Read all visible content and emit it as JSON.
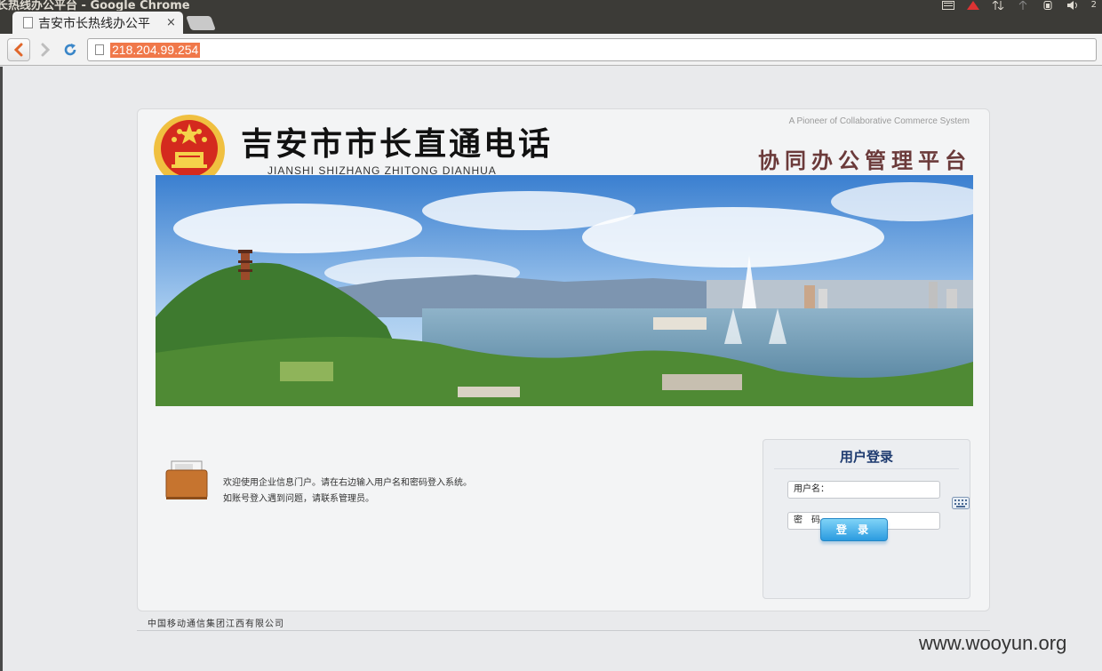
{
  "window": {
    "title": "长热线办公平台 - Google Chrome",
    "clock": "2"
  },
  "tab": {
    "title": "吉安市长热线办公平",
    "close": "×"
  },
  "toolbar": {
    "url": "218.204.99.254"
  },
  "header": {
    "brand_cn": "吉安市市长直通电话",
    "brand_pinyin": "JIANSHI SHIZHANG ZHITONG DIANHUA",
    "tagline_en": "A Pioneer of Collaborative Commerce System",
    "platform_name": "协同办公管理平台"
  },
  "welcome": {
    "line1": "欢迎使用企业信息门户。请在右边输入用户名和密码登入系统。",
    "line2": "如账号登入遇到问题，请联系管理员。"
  },
  "login": {
    "title": "用户登录",
    "username_label": "用户名：",
    "password_label": "密　码",
    "button": "登 录"
  },
  "footer": {
    "company": "中国移动通信集团江西有限公司"
  },
  "watermark": "www.wooyun.org",
  "colors": {
    "url_highlight": "#f0784a",
    "login_title": "#1e3b70",
    "login_button": "#2b9be0",
    "platform_name": "#6b3a3a"
  }
}
